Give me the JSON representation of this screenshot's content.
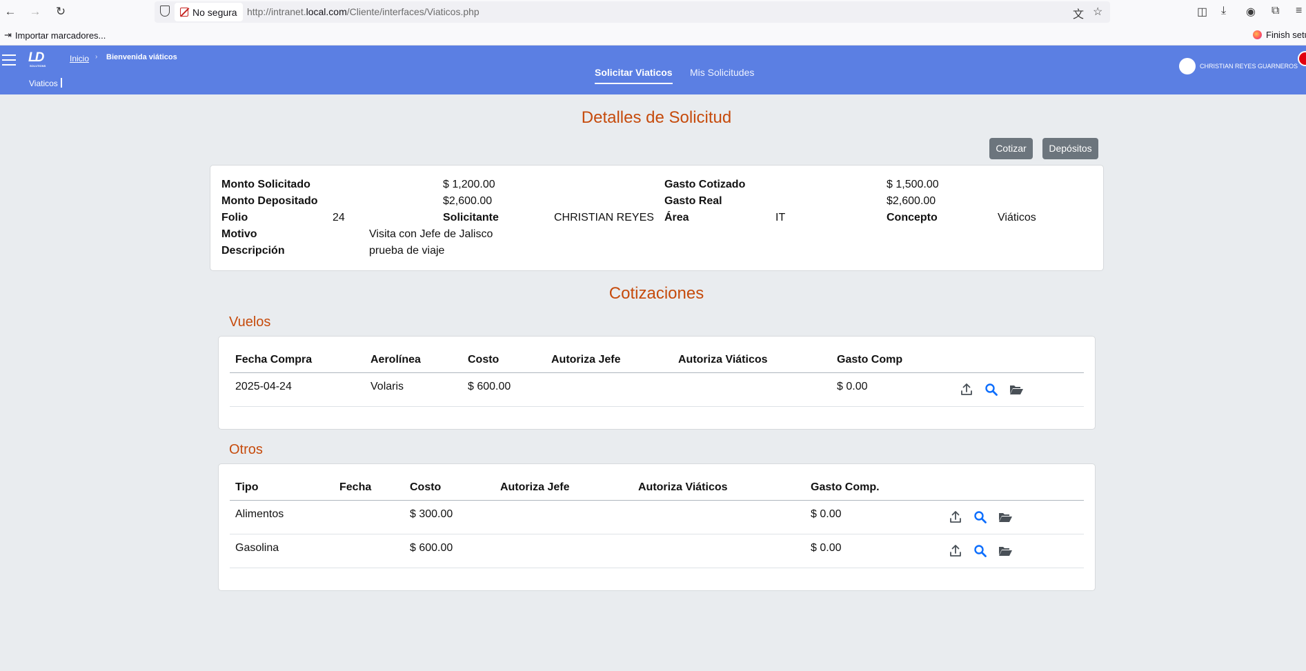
{
  "browser": {
    "security_label": "No segura",
    "url_prefix": "http://intranet.",
    "url_domain": "local.com",
    "url_path": "/Cliente/interfaces/Viaticos.php",
    "bookmark_import": "Importar marcadores...",
    "bookmark_finish": "Finish setup"
  },
  "header": {
    "breadcrumb_home": "Inicio",
    "breadcrumb_sep": "›",
    "breadcrumb_current": "Bienvenida viáticos",
    "subtitle": "Viaticos",
    "logo_text": "LD",
    "logo_sub": "SOLUTIONS",
    "tabs": [
      {
        "label": "Solicitar Viaticos",
        "active": true
      },
      {
        "label": "Mis Solicitudes",
        "active": false
      }
    ],
    "user_name": "CHRISTIAN REYES GUARNEROS"
  },
  "page": {
    "title": "Detalles de Solicitud",
    "buttons": {
      "cotizar": "Cotizar",
      "depositos": "Depósitos"
    }
  },
  "details": {
    "monto_solicitado_label": "Monto Solicitado",
    "monto_solicitado_value": "$ 1,200.00",
    "gasto_cotizado_label": "Gasto Cotizado",
    "gasto_cotizado_value": "$ 1,500.00",
    "monto_depositado_label": "Monto Depositado",
    "monto_depositado_value": "$2,600.00",
    "gasto_real_label": "Gasto Real",
    "gasto_real_value": "$2,600.00",
    "folio_label": "Folio",
    "folio_value": "24",
    "solicitante_label": "Solicitante",
    "solicitante_value": "CHRISTIAN REYES",
    "area_label": "Área",
    "area_value": "IT",
    "concepto_label": "Concepto",
    "concepto_value": "Viáticos",
    "motivo_label": "Motivo",
    "motivo_value": "Visita con Jefe de Jalisco",
    "descripcion_label": "Descripción",
    "descripcion_value": "prueba de viaje"
  },
  "cotizaciones": {
    "title": "Cotizaciones",
    "vuelos": {
      "title": "Vuelos",
      "headers": [
        "Fecha Compra",
        "Aerolínea",
        "Costo",
        "Autoriza Jefe",
        "Autoriza Viáticos",
        "Gasto Comp"
      ],
      "rows": [
        {
          "fecha": "2025-04-24",
          "aerolinea": "Volaris",
          "costo": "$ 600.00",
          "jefe": "",
          "viaticos": "",
          "gasto": "$ 0.00"
        }
      ]
    },
    "otros": {
      "title": "Otros",
      "headers": [
        "Tipo",
        "Fecha",
        "Costo",
        "Autoriza Jefe",
        "Autoriza Viáticos",
        "Gasto Comp."
      ],
      "rows": [
        {
          "tipo": "Alimentos",
          "fecha": "",
          "costo": "$ 300.00",
          "jefe": "",
          "viaticos": "",
          "gasto": "$ 0.00"
        },
        {
          "tipo": "Gasolina",
          "fecha": "",
          "costo": "$ 600.00",
          "jefe": "",
          "viaticos": "",
          "gasto": "$ 0.00"
        }
      ]
    },
    "action_icons": [
      "upload-icon",
      "search-icon",
      "folder-open-icon"
    ]
  },
  "colors": {
    "header_bg": "#5b7fe3",
    "title_orange": "#c64b0c",
    "button_gray": "#6c757d",
    "page_bg": "#e9ecef",
    "search_blue": "#0d6efd"
  }
}
